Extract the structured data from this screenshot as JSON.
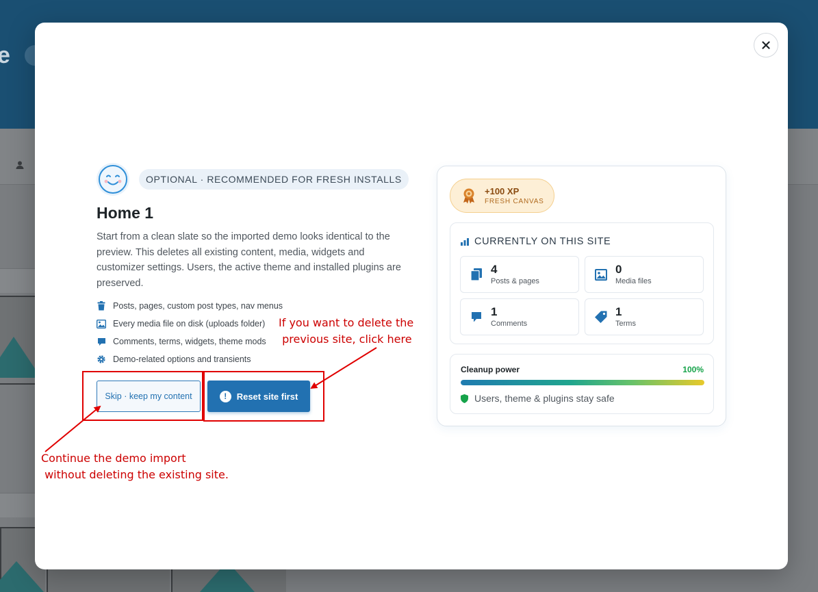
{
  "modal": {
    "badge": "OPTIONAL · RECOMMENDED FOR FRESH INSTALLS",
    "title": "Home 1",
    "description": "Start from a clean slate so the imported demo looks identical to the preview. This deletes all existing content, media, widgets and customizer settings. Users, the active theme and installed plugins are preserved.",
    "list": [
      {
        "label": "Posts, pages, custom post types, nav menus",
        "icon": "trash-icon"
      },
      {
        "label": "Every media file on disk (uploads folder)",
        "icon": "image-icon"
      },
      {
        "label": "Comments, terms, widgets, theme mods",
        "icon": "comment-icon"
      },
      {
        "label": "Demo-related options and transients",
        "icon": "gear-icon"
      }
    ],
    "skip_button": "Skip · keep my content",
    "reset_button": "Reset site first",
    "reset_icon": "!",
    "close_icon": "close-icon"
  },
  "panel": {
    "xp_main": "+100 XP",
    "xp_sub": "FRESH CANVAS",
    "stats_title": "CURRENTLY ON THIS SITE",
    "stats": [
      {
        "num": "4",
        "label": "Posts & pages",
        "icon": "pages-icon"
      },
      {
        "num": "0",
        "label": "Media files",
        "icon": "media-icon"
      },
      {
        "num": "1",
        "label": "Comments",
        "icon": "comment-icon"
      },
      {
        "num": "1",
        "label": "Terms",
        "icon": "tag-icon"
      }
    ],
    "power_label": "Cleanup power",
    "power_pct": "100%",
    "power_value": 1.0,
    "power_note": "Users, theme & plugins stay safe"
  },
  "annotations": {
    "right_note": "If you want to delete the\n previous site, click here",
    "left_note": "Continue the demo import\n without deleting the existing site."
  },
  "colors": {
    "accent": "#2271b1",
    "annotation": "#e00000",
    "success": "#16a34a"
  }
}
